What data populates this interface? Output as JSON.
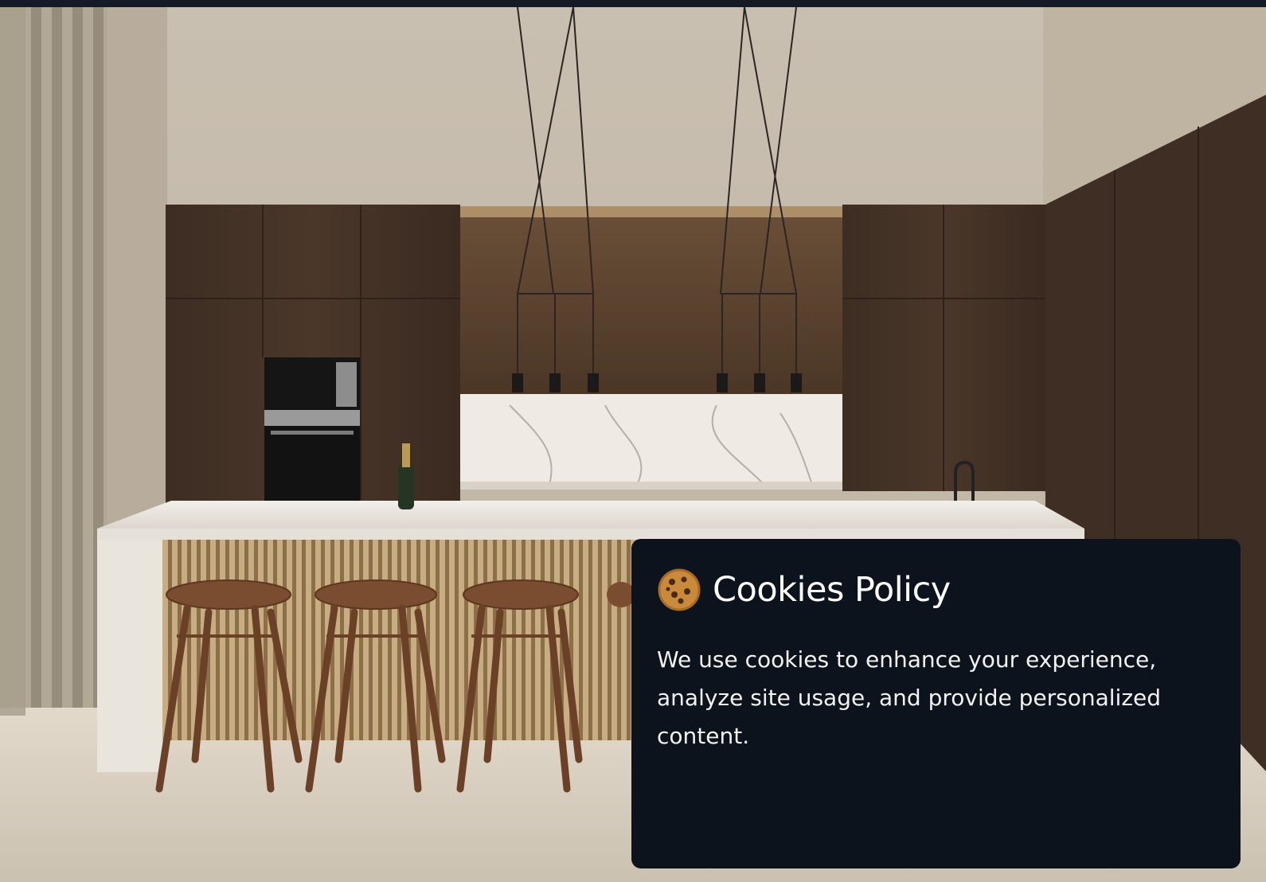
{
  "hero": {
    "image_icon": "kitchen-interior-photo"
  },
  "cookie_banner": {
    "icon": "cookie-icon",
    "title": "Cookies Policy",
    "message": "We use cookies to enhance your experience, analyze site usage, and provide personalized content."
  },
  "colors": {
    "panel_background": "#0d131c",
    "top_bar": "#141b26",
    "text": "#ffffff"
  }
}
